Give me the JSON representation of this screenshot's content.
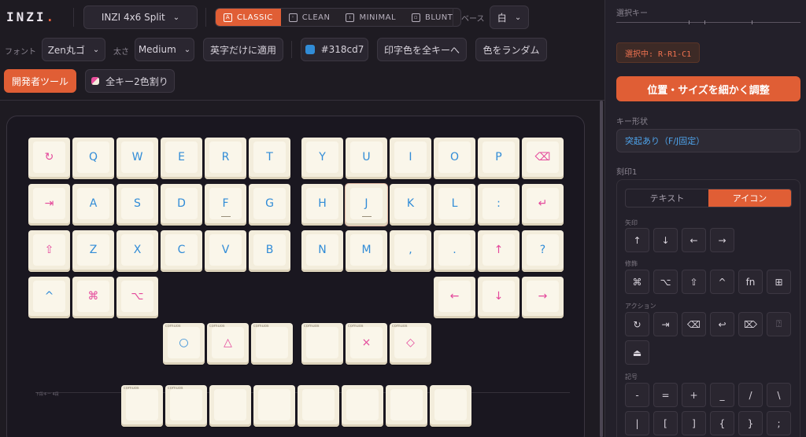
{
  "app": {
    "logo": "INZI",
    "logo_dot": "."
  },
  "toolbar": {
    "layout_select": "INZI 4x6 Split",
    "styles": [
      {
        "label": "CLASSIC",
        "icon": "A",
        "active": true
      },
      {
        "label": "CLEAN",
        "icon": "◦",
        "active": false
      },
      {
        "label": "MINIMAL",
        "icon": "ı",
        "active": false
      },
      {
        "label": "BLUNT",
        "icon": "▫",
        "active": false
      }
    ],
    "base_label": "ベース",
    "base_value": "白",
    "font_label": "フォント",
    "font_value": "Zen丸ゴ",
    "weight_label": "太さ",
    "weight_value": "Medium",
    "latin_only_button": "英字だけに適用",
    "color_value": "#318cd7",
    "apply_all_button": "印字色を全キーへ",
    "random_button": "色をランダム",
    "dev_tools_button": "開発者ツール",
    "two_color_button": "全キー2色割り"
  },
  "board": {
    "section_label": "下段キー 4段",
    "left_keys": [
      [
        "↻",
        "Q",
        "W",
        "E",
        "R",
        "T"
      ],
      [
        "⇥",
        "A",
        "S",
        "D",
        "F",
        "G"
      ],
      [
        "⇧",
        "Z",
        "X",
        "C",
        "V",
        "B"
      ],
      [
        "^",
        "⌘",
        "⌥"
      ]
    ],
    "right_keys": [
      [
        "Y",
        "U",
        "I",
        "O",
        "P",
        "⌫"
      ],
      [
        "H",
        "J",
        "K",
        "L",
        ":",
        "↵"
      ],
      [
        "N",
        "M",
        ",",
        ".",
        "↑",
        "?"
      ],
      [
        "←",
        "↓",
        "→"
      ]
    ],
    "thumb_left": [
      "○",
      "△",
      ""
    ],
    "thumb_right": [
      "",
      "×",
      "◇"
    ],
    "thumb_mini_label": "comuos",
    "bottom_row_count_label": "comuos"
  },
  "panel": {
    "selected_key_label": "選択キー",
    "selected_badge": "選択中: R-R1-C1",
    "adjust_button": "位置・サイズを細かく調整",
    "shape_label": "キー形状",
    "shape_value": "突起あり（F/J固定）",
    "legend_label": "刻印1",
    "tab_text": "テキスト",
    "tab_icon": "アイコン",
    "arrow_group": "矢印",
    "arrows": [
      "↑",
      "↓",
      "←",
      "→"
    ],
    "mod_group": "修飾",
    "mods": [
      "⌘",
      "⌥",
      "⇧",
      "^",
      "fn",
      "⊞"
    ],
    "action_group": "アクション",
    "actions": [
      "↻",
      "⇥",
      "⌫",
      "↩",
      "⌦",
      "⍰",
      "⏏"
    ],
    "symbol_group": "記号",
    "symbols_row1": [
      "-",
      "=",
      "+",
      "_",
      "/",
      "\\"
    ],
    "symbols_row2": [
      "|",
      "[",
      "]",
      "{",
      "}",
      ";"
    ]
  },
  "colors": {
    "accent": "#e05e35",
    "legend": "#318cd7",
    "keycap": "#f3eddc"
  }
}
